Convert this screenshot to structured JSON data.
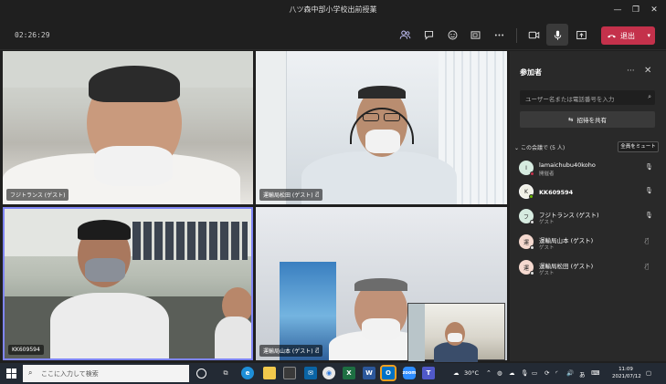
{
  "window": {
    "title": "八ツ森中部小学校出前授業",
    "controls": [
      "—",
      "❐",
      "✕"
    ]
  },
  "toolbar": {
    "timer": "02:26:29",
    "icons": [
      "participants-icon",
      "chat-icon",
      "reactions-icon",
      "rooms-icon",
      "more-icon",
      "camera-icon",
      "mic-icon",
      "share-tray-icon"
    ],
    "leave_label": "退出",
    "leave_color": "#c4314b"
  },
  "videos": [
    {
      "name": "フジトランス (ゲスト)"
    },
    {
      "name": "運輸局松田 (ゲスト)",
      "muted": true
    },
    {
      "name": "KK609594",
      "highlight_color": "#7f85f5"
    },
    {
      "name": "運輸局山本 (ゲスト)",
      "muted": true
    }
  ],
  "panel": {
    "title": "参加者",
    "search_placeholder": "ユーザー名または電話番号を入力",
    "share_label": "招待を共有",
    "section_label": "この会議で (5 人)",
    "mute_all_label": "全員をミュート",
    "participants": [
      {
        "initial": "I",
        "name": "lamaichubu40koho",
        "role": "開催者",
        "avatar_color": "#d6ebe0",
        "status_color": "#c4314b",
        "mic": "mic-icon"
      },
      {
        "initial": "K",
        "name": "KK609594",
        "role": "",
        "avatar_color": "#f0f0e6",
        "status_color": "#6bb700",
        "mic": "mic-icon"
      },
      {
        "initial": "フ",
        "name": "フジトランス (ゲスト)",
        "role": "ゲスト",
        "avatar_color": "#d6ebe0",
        "status_color": "#e0e0e0",
        "mic": "mic-icon"
      },
      {
        "initial": "運",
        "name": "運輸局山本 (ゲスト)",
        "role": "ゲスト",
        "avatar_color": "#f5d9cf",
        "status_color": "#e0e0e0",
        "mic": "mic-muted-icon"
      },
      {
        "initial": "運",
        "name": "運輸局松田 (ゲスト)",
        "role": "ゲスト",
        "avatar_color": "#f5d9cf",
        "status_color": "#e0e0e0",
        "mic": "mic-muted-icon"
      }
    ]
  },
  "taskbar": {
    "search_placeholder": "ここに入力して検索",
    "weather": "30°C",
    "ime_label": "あ",
    "time": "11:09",
    "date": "2021/07/12"
  }
}
